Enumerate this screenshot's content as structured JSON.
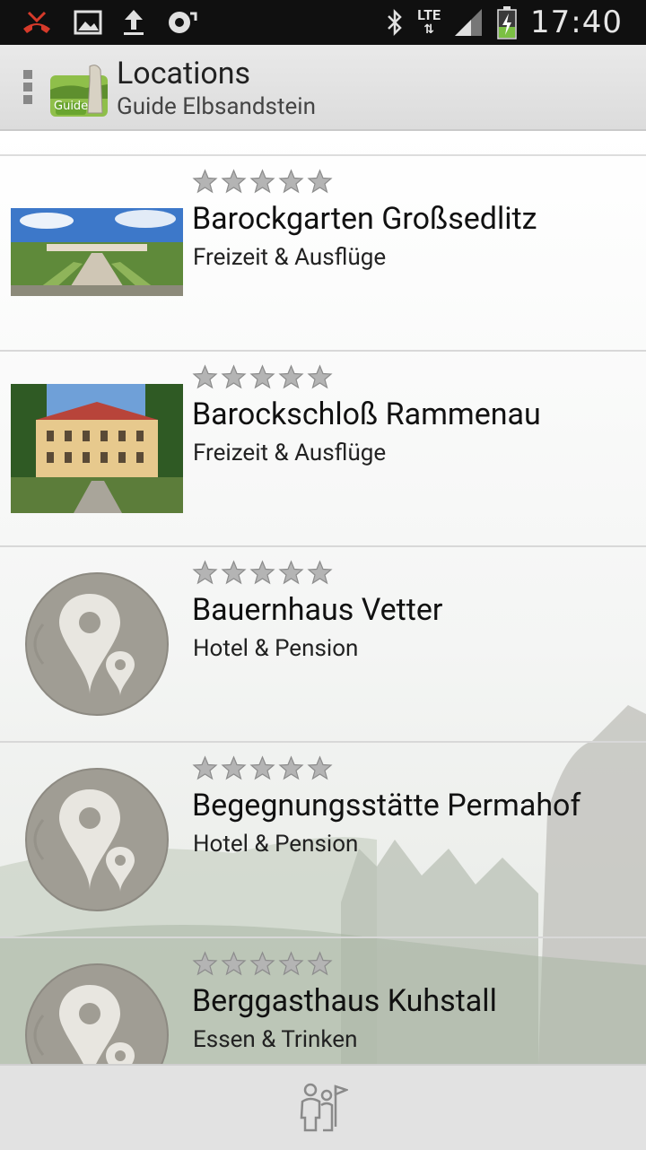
{
  "status_bar": {
    "time": "17:40",
    "network": "LTE",
    "icons": [
      "missed-call-icon",
      "gallery-icon",
      "upload-icon",
      "sync-icon",
      "bluetooth-icon",
      "signal-icon",
      "battery-charging-icon"
    ]
  },
  "action_bar": {
    "title": "Locations",
    "subtitle": "Guide Elbsandstein",
    "logo_badge": "Guide"
  },
  "locations": [
    {
      "name": "Barockgarten Großsedlitz",
      "category": "Freizeit & Ausflüge",
      "rating": 0,
      "image": "garden-photo"
    },
    {
      "name": "Barockschloß Rammenau",
      "category": "Freizeit & Ausflüge",
      "rating": 0,
      "image": "castle-photo"
    },
    {
      "name": "Bauernhaus Vetter",
      "category": "Hotel & Pension",
      "rating": 0,
      "image": "placeholder-pin"
    },
    {
      "name": "Begegnungsstätte Permahof",
      "category": "Hotel & Pension",
      "rating": 0,
      "image": "placeholder-pin"
    },
    {
      "name": "Berggasthaus Kuhstall",
      "category": "Essen & Trinken",
      "rating": 0,
      "image": "placeholder-pin"
    }
  ],
  "bottom_bar": {
    "icon": "tour-guide-icon"
  },
  "colors": {
    "status_bar": "#101010",
    "action_bar": "#e2e2e2",
    "star": "#9a9a9a",
    "pin_circle": "#a09d94"
  }
}
